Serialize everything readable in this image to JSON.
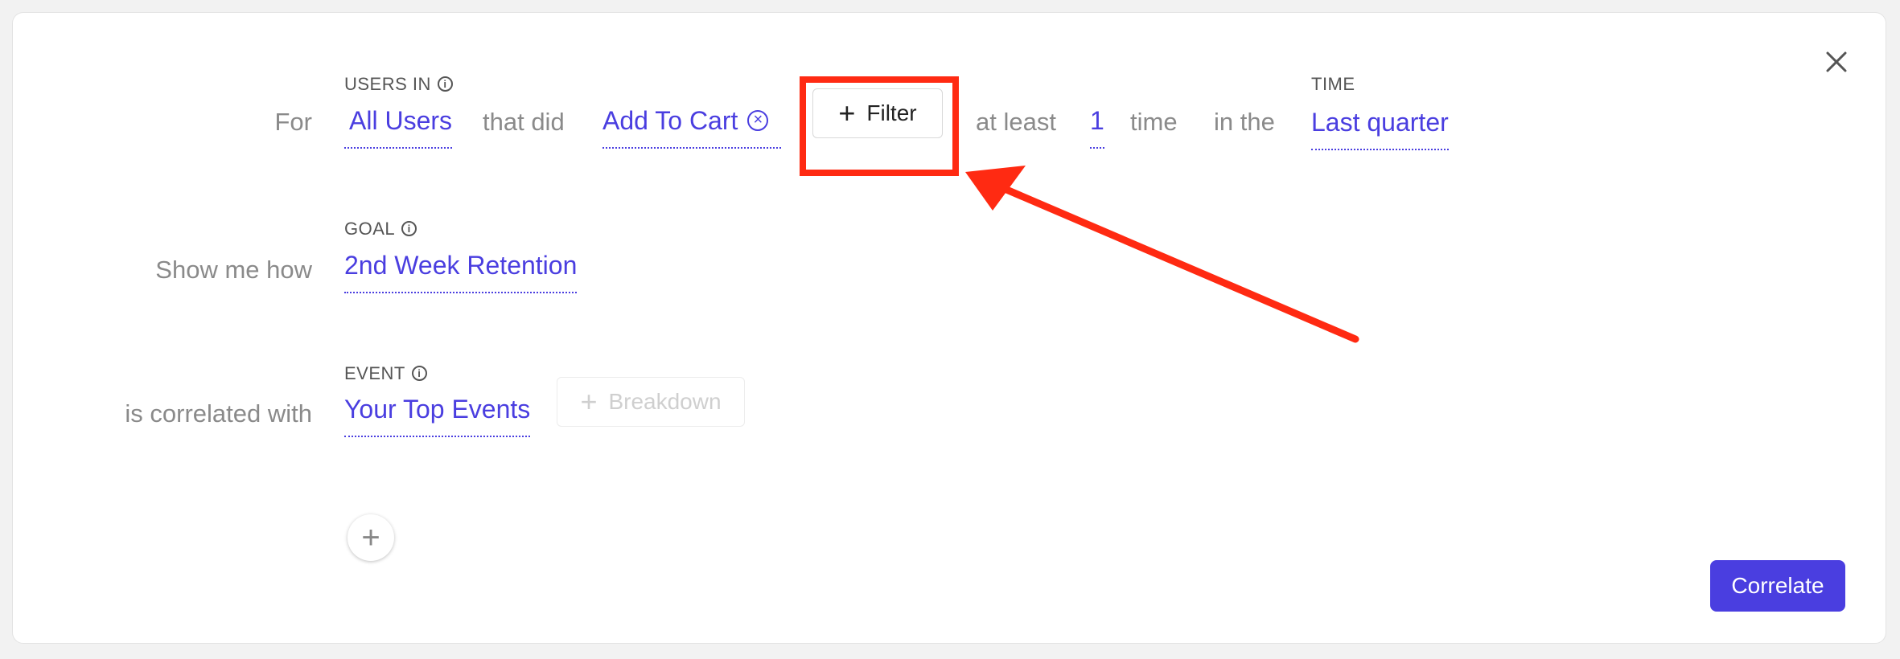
{
  "row_for": {
    "prefix": "For",
    "users_in_label": "USERS IN",
    "users_value": "All Users",
    "connector": "that did",
    "event_value": "Add To Cart",
    "filter_button": "Filter",
    "at_least": "at least",
    "count_value": "1",
    "time_word": "time",
    "in_the": "in the",
    "time_label": "TIME",
    "time_value": "Last quarter"
  },
  "row_goal": {
    "prefix": "Show me how",
    "goal_label": "GOAL",
    "goal_value": "2nd Week Retention"
  },
  "row_event": {
    "prefix": "is correlated with",
    "event_label": "EVENT",
    "event_value": "Your Top Events",
    "breakdown_button": "Breakdown"
  },
  "actions": {
    "correlate_button": "Correlate"
  },
  "icons": {
    "info": "info-icon",
    "clear": "clear-circle-icon",
    "plus": "plus-icon",
    "close": "close-icon"
  },
  "colors": {
    "accent": "#4a3ee0",
    "annotation": "#ff2a12",
    "muted_text": "#8a8a8a"
  }
}
